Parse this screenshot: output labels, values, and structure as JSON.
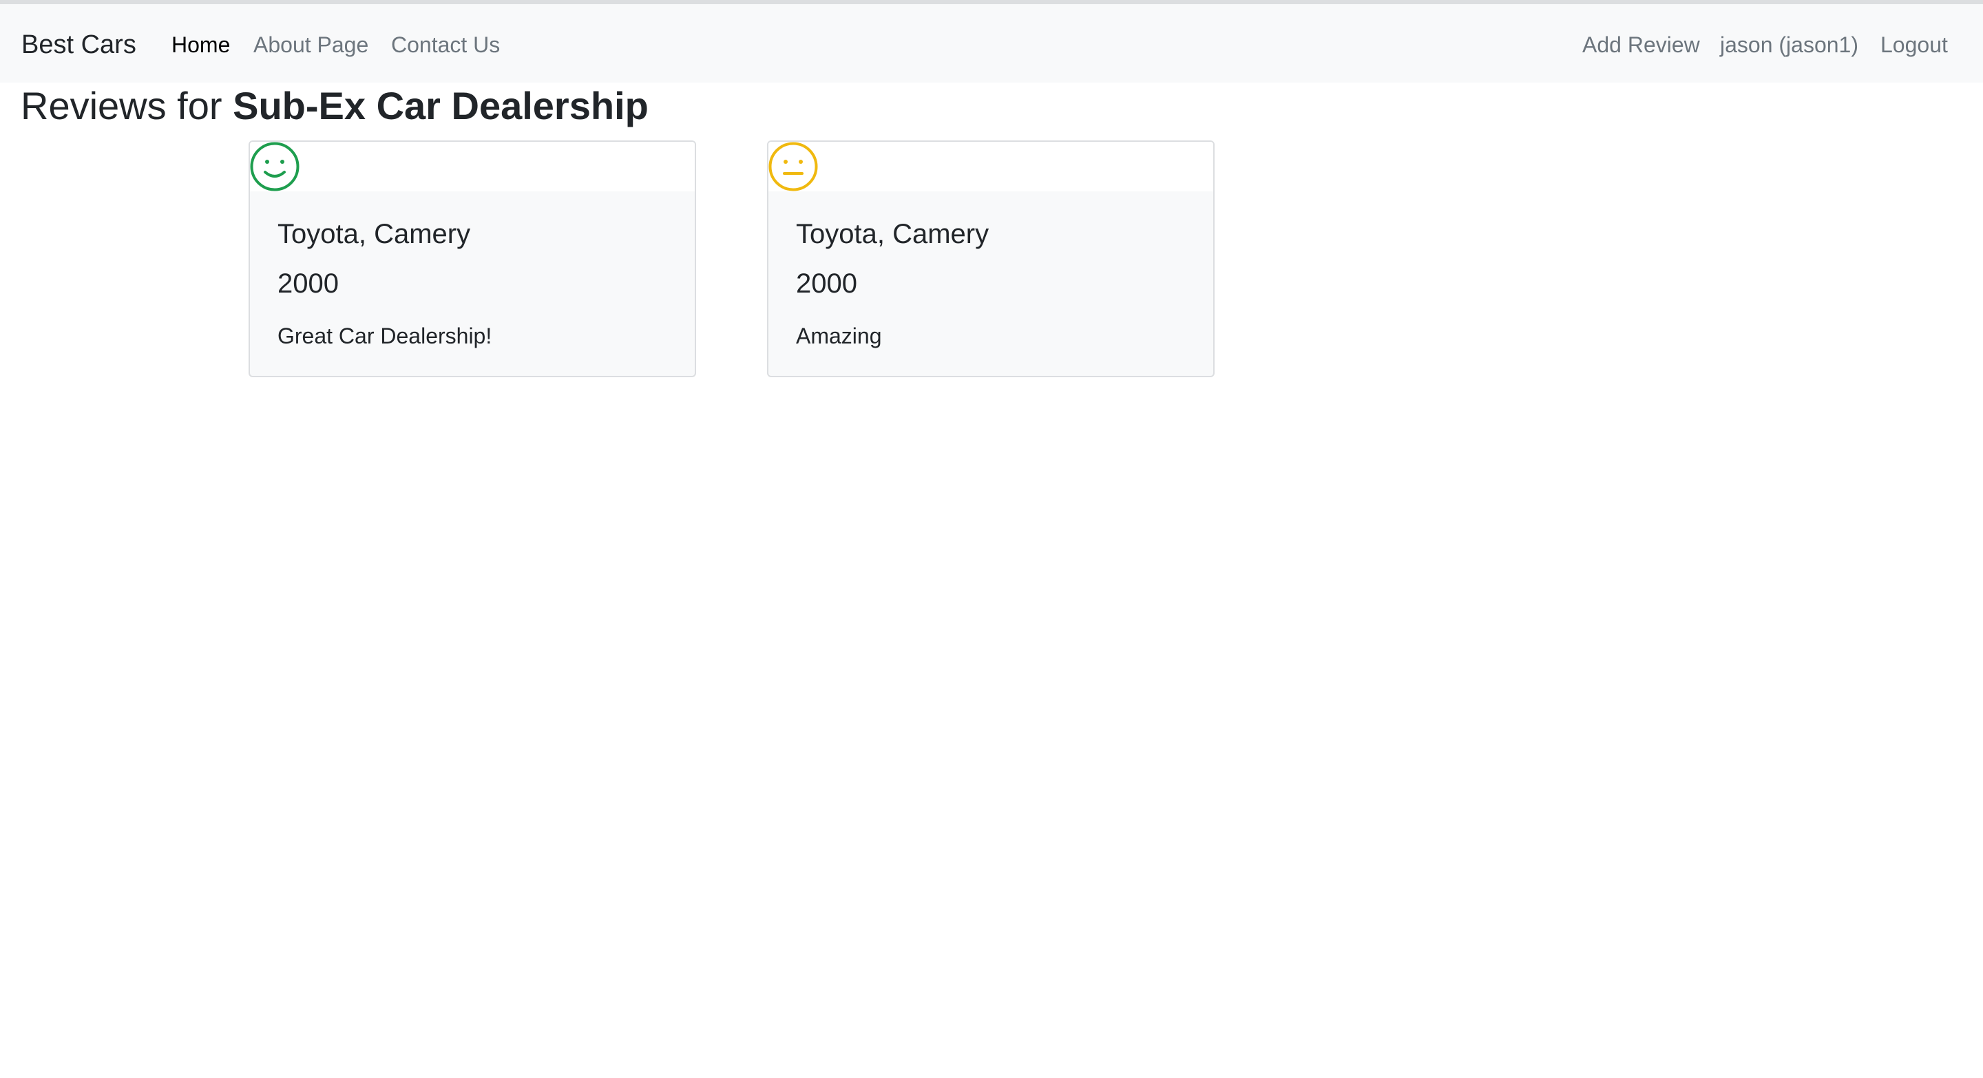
{
  "navbar": {
    "brand": "Best Cars",
    "links": [
      {
        "label": "Home",
        "active": true
      },
      {
        "label": "About Page",
        "active": false
      },
      {
        "label": "Contact Us",
        "active": false
      }
    ],
    "right_links": [
      {
        "label": "Add Review"
      },
      {
        "label": "jason (jason1)"
      },
      {
        "label": "Logout"
      }
    ]
  },
  "page": {
    "title_prefix": "Reviews for ",
    "dealer_name": "Sub-Ex Car Dealership"
  },
  "reviews": [
    {
      "sentiment": "positive",
      "sentiment_icon": "smiley-icon",
      "sentiment_color": "#1e9e4e",
      "car": "Toyota, Camery",
      "year": "2000",
      "text": "Great Car Dealership!"
    },
    {
      "sentiment": "neutral",
      "sentiment_icon": "neutral-face-icon",
      "sentiment_color": "#f0b90f",
      "car": "Toyota, Camery",
      "year": "2000",
      "text": "Amazing"
    }
  ]
}
